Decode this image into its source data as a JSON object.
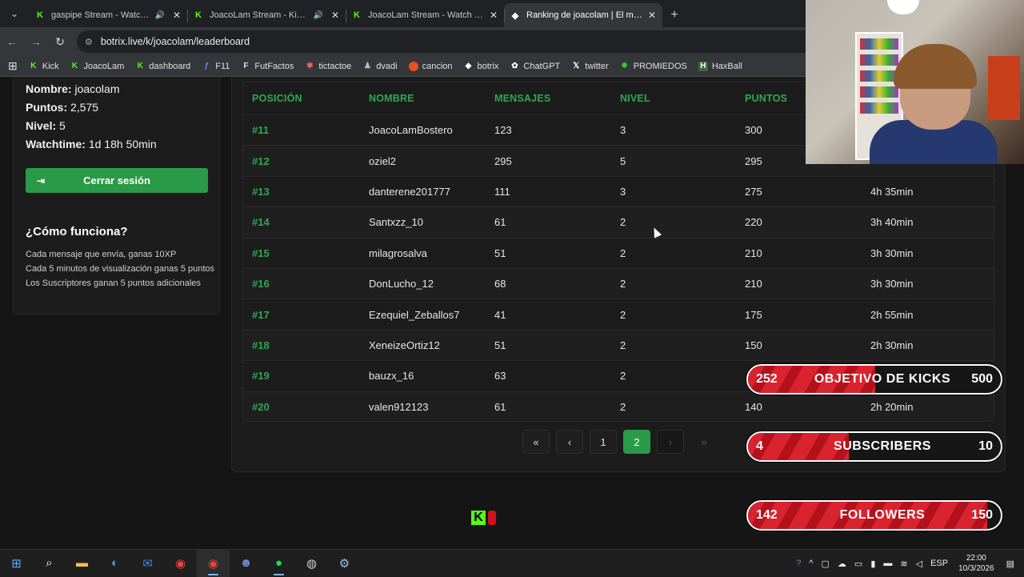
{
  "browser": {
    "tabs": [
      {
        "title": "gaspipe Stream - Watch Live",
        "audio": true,
        "active": false
      },
      {
        "title": "JoacoLam Stream - Kick Dashboard",
        "audio": true,
        "active": false
      },
      {
        "title": "JoacoLam Stream - Watch Live on Kick",
        "audio": false,
        "active": false
      },
      {
        "title": "Ranking de joacolam | El mejor",
        "audio": false,
        "active": true
      }
    ],
    "url": "botrix.live/k/joacolam/leaderboard",
    "bookmarks": [
      "Kick",
      "JoacoLam",
      "dashboard",
      "F11",
      "FutFactos",
      "tictactoe",
      "dvadi",
      "cancion",
      "botrix",
      "ChatGPT",
      "twitter",
      "PROMIEDOS",
      "HaxBall"
    ]
  },
  "profile": {
    "nombre_label": "Nombre:",
    "nombre": "joacolam",
    "puntos_label": "Puntos:",
    "puntos": "2,575",
    "nivel_label": "Nivel:",
    "nivel": "5",
    "watchtime_label": "Watchtime:",
    "watchtime": "1d 18h 50min",
    "logout_label": "Cerrar sesión"
  },
  "how": {
    "title": "¿Cómo funciona?",
    "rules": [
      "Cada mensaje que envía, ganas 10XP",
      "Cada 5 minutos de visualización ganas 5 puntos",
      "Los Suscriptores ganan 5 puntos adicionales"
    ]
  },
  "leaderboard": {
    "headers": [
      "POSICIÓN",
      "NOMBRE",
      "MENSAJES",
      "NIVEL",
      "PUNTOS",
      ""
    ],
    "rows": [
      [
        "#11",
        "JoacoLamBostero",
        "123",
        "3",
        "300",
        ""
      ],
      [
        "#12",
        "oziel2",
        "295",
        "5",
        "295",
        ""
      ],
      [
        "#13",
        "danterene201777",
        "111",
        "3",
        "275",
        "4h 35min"
      ],
      [
        "#14",
        "Santxzz_10",
        "61",
        "2",
        "220",
        "3h 40min"
      ],
      [
        "#15",
        "milagrosalva",
        "51",
        "2",
        "210",
        "3h 30min"
      ],
      [
        "#16",
        "DonLucho_12",
        "68",
        "2",
        "210",
        "3h 30min"
      ],
      [
        "#17",
        "Ezequiel_Zeballos7",
        "41",
        "2",
        "175",
        "2h 55min"
      ],
      [
        "#18",
        "XeneizeOrtiz12",
        "51",
        "2",
        "150",
        "2h 30min"
      ],
      [
        "#19",
        "bauzx_16",
        "63",
        "2",
        "",
        ""
      ],
      [
        "#20",
        "valen912123",
        "61",
        "2",
        "140",
        "2h 20min"
      ]
    ]
  },
  "pagination": {
    "first": "«",
    "prev": "‹",
    "pages": [
      "1",
      "2"
    ],
    "current": "2",
    "next": "›",
    "last": "»"
  },
  "overlays": [
    {
      "current": "252",
      "label": "OBJETIVO DE KICKS",
      "goal": "500",
      "fraction": 0.504
    },
    {
      "current": "4",
      "label": "SUBSCRIBERS",
      "goal": "10",
      "fraction": 0.4
    },
    {
      "current": "142",
      "label": "FOLLOWERS",
      "goal": "150",
      "fraction": 0.947
    }
  ],
  "taskbar": {
    "time": "22:00",
    "date": "10/3/2026",
    "lang": "ESP"
  },
  "colors": {
    "accent_green": "#2ea84f",
    "kick_green": "#53fc18",
    "overlay_red": "#d9232e"
  }
}
